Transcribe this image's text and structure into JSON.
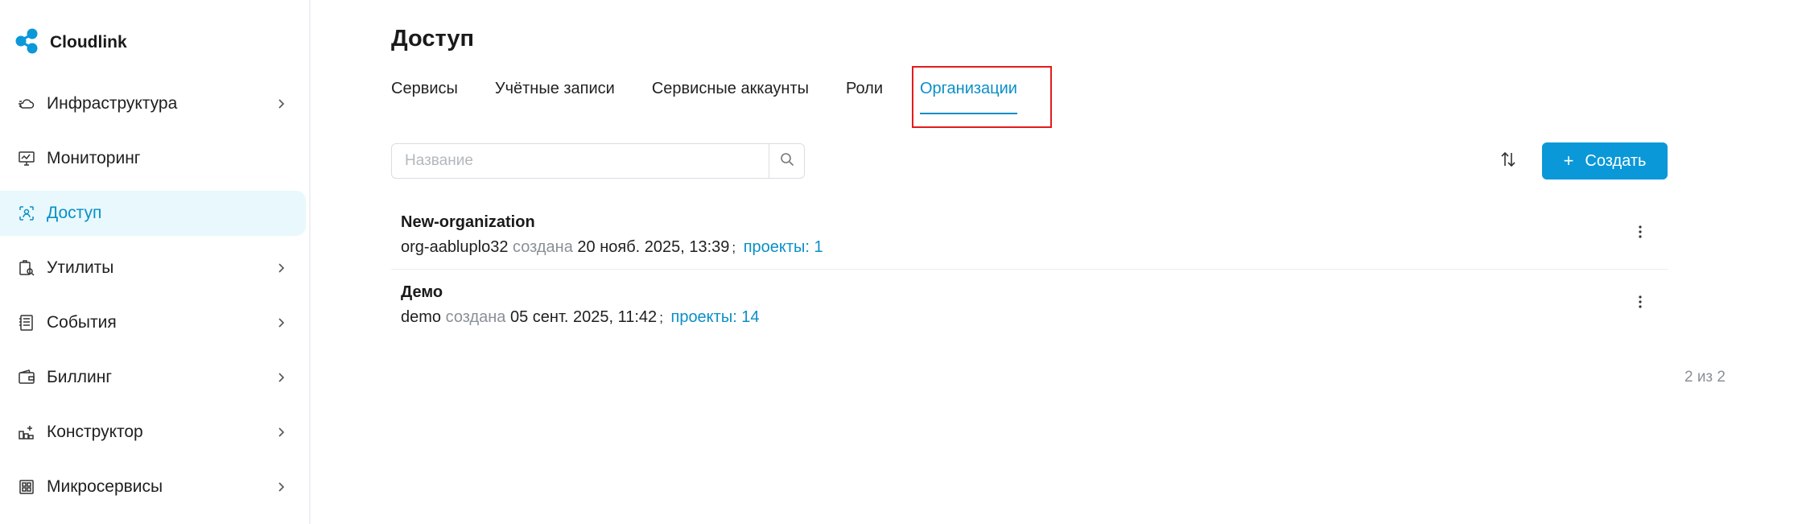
{
  "brand": {
    "name": "Cloudlink",
    "accent": "#0a98d8"
  },
  "sidebar": {
    "items": [
      {
        "label": "Инфраструктура",
        "icon": "cloud-icon",
        "has_children": true,
        "active": false
      },
      {
        "label": "Мониторинг",
        "icon": "monitor-icon",
        "has_children": false,
        "active": false
      },
      {
        "label": "Доступ",
        "icon": "access-icon",
        "has_children": false,
        "active": true
      },
      {
        "label": "Утилиты",
        "icon": "tools-icon",
        "has_children": true,
        "active": false
      },
      {
        "label": "События",
        "icon": "events-icon",
        "has_children": true,
        "active": false
      },
      {
        "label": "Биллинг",
        "icon": "wallet-icon",
        "has_children": true,
        "active": false
      },
      {
        "label": "Конструктор",
        "icon": "constructor-icon",
        "has_children": true,
        "active": false
      },
      {
        "label": "Микросервисы",
        "icon": "microservices-icon",
        "has_children": true,
        "active": false
      }
    ]
  },
  "page": {
    "title": "Доступ"
  },
  "tabs": [
    {
      "label": "Сервисы",
      "active": false
    },
    {
      "label": "Учётные записи",
      "active": false
    },
    {
      "label": "Сервисные аккаунты",
      "active": false
    },
    {
      "label": "Роли",
      "active": false
    },
    {
      "label": "Организации",
      "active": true
    }
  ],
  "toolbar": {
    "search_placeholder": "Название",
    "search_value": "",
    "create_label": "Создать"
  },
  "organizations": [
    {
      "name": "New-organization",
      "slug": "org-aabluplo32",
      "created_label": "создана",
      "created_at": "20 нояб. 2025, 13:39",
      "separator": ";",
      "projects": "проекты: 1"
    },
    {
      "name": "Демо",
      "slug": "demo",
      "created_label": "создана",
      "created_at": "05 сент. 2025, 11:42",
      "separator": ";",
      "projects": "проекты: 14"
    }
  ],
  "pagination": {
    "summary": "2 из 2"
  }
}
